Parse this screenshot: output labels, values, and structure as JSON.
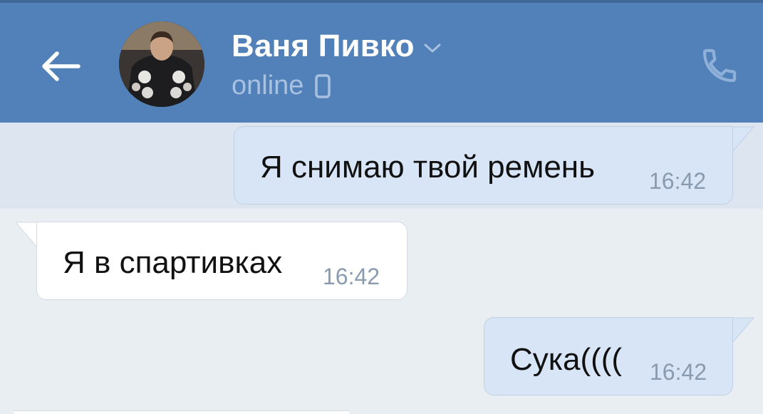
{
  "header": {
    "name": "Ваня Пивко",
    "status": "online",
    "icons": {
      "back": "arrow-left-icon",
      "chevron": "chevron-down-icon",
      "mobile": "mobile-phone-icon",
      "call": "phone-call-icon"
    },
    "colors": {
      "bar": "#5181b8",
      "title": "#ffffff",
      "status": "#a8c1e0"
    }
  },
  "messages": [
    {
      "direction": "outgoing",
      "text": "Я снимаю твой ремень",
      "time": "16:42"
    },
    {
      "direction": "incoming",
      "text": "Я в спартивках",
      "time": "16:42"
    },
    {
      "direction": "outgoing",
      "text": "Сука((((",
      "time": "16:42"
    }
  ],
  "colors": {
    "background": "#e9eef3",
    "outgoing_bubble": "#d7e5f6",
    "incoming_bubble": "#ffffff",
    "time": "#8a9bb0"
  }
}
